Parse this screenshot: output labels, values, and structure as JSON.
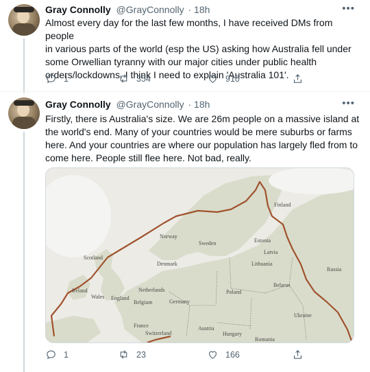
{
  "tweets": [
    {
      "author": "Gray Connolly",
      "handle": "@GrayConnolly",
      "time": "· 18h",
      "more_icon": "more-dots-icon",
      "text_lines": [
        "Almost every day for the last few months, I have received DMs from people",
        "in various parts of the world (esp the US) asking how Australia fell under",
        "some Orwellian tyranny with our major cities under public health",
        "orders/lockdowns. I think I need to explain 'Australia 101'."
      ],
      "replies": "1",
      "retweets": "354",
      "likes": "910"
    },
    {
      "author": "Gray Connolly",
      "handle": "@GrayConnolly",
      "time": "· 18h",
      "more_icon": "more-dots-icon",
      "text_lines": [
        "Firstly, there is Australia's size. We are 26m people on a massive island at",
        "the world's end. Many of your countries would be mere suburbs or farms",
        "here. And your countries are where our population has largely fled from to",
        "come here. People still flee here. Not bad, really."
      ],
      "replies": "1",
      "retweets": "23",
      "likes": "166",
      "map_labels": {
        "finland": "Finland",
        "norway": "Norway",
        "sweden": "Sweden",
        "estonia": "Estonia",
        "latvia": "Latvia",
        "lithuania": "Lithuania",
        "russia": "Russia",
        "scotland": "Scotland",
        "denmark": "Denmark",
        "ireland": "Ireland",
        "wales": "Wales",
        "england": "England",
        "netherlands": "Netherlands",
        "belgium": "Belgium",
        "germany": "Germany",
        "poland": "Poland",
        "belarus": "Belarus",
        "ukraine": "Ukraine",
        "france": "France",
        "switzerland": "Switzerland",
        "austria": "Austria",
        "hungary": "Hungary",
        "romania": "Romania"
      }
    }
  ],
  "colors": {
    "text": "#0f1419",
    "secondary": "#536471",
    "outline": "#a0522d"
  }
}
